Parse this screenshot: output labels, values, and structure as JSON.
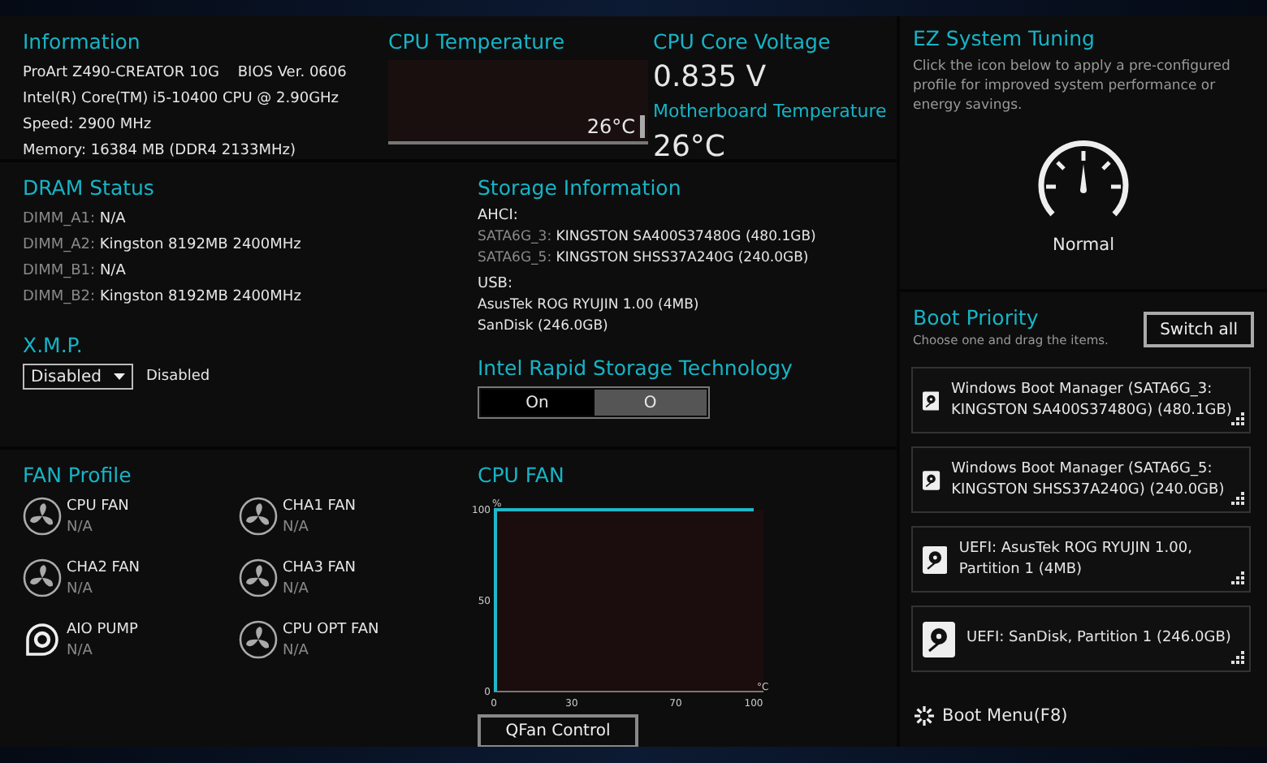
{
  "information": {
    "title": "Information",
    "lines": [
      "ProArt Z490-CREATOR 10G    BIOS Ver. 0606",
      "Intel(R) Core(TM) i5-10400 CPU @ 2.90GHz",
      "Speed: 2900 MHz",
      "Memory: 16384 MB (DDR4 2133MHz)"
    ]
  },
  "cpu_temperature": {
    "title": "CPU Temperature",
    "reading": "26°C"
  },
  "voltage": {
    "title": "CPU Core Voltage",
    "value": "0.835 V",
    "mb_title": "Motherboard Temperature",
    "mb_value": "26°C"
  },
  "dram": {
    "title": "DRAM Status",
    "slots": [
      {
        "label": "DIMM_A1:",
        "value": "N/A"
      },
      {
        "label": "DIMM_A2:",
        "value": "Kingston 8192MB 2400MHz"
      },
      {
        "label": "DIMM_B1:",
        "value": "N/A"
      },
      {
        "label": "DIMM_B2:",
        "value": "Kingston 8192MB 2400MHz"
      }
    ]
  },
  "storage": {
    "title": "Storage Information",
    "groups": [
      {
        "heading": "AHCI:",
        "items": [
          {
            "label": "SATA6G_3:",
            "value": "KINGSTON SA400S37480G (480.1GB)"
          },
          {
            "label": "SATA6G_5:",
            "value": "KINGSTON SHSS37A240G (240.0GB)"
          }
        ]
      },
      {
        "heading": "USB:",
        "items": [
          {
            "value": "AsusTek ROG RYUJIN 1.00 (4MB)"
          },
          {
            "value": "SanDisk (246.0GB)"
          }
        ]
      }
    ]
  },
  "xmp": {
    "title": "X.M.P.",
    "value": "Disabled",
    "status": "Disabled"
  },
  "rst": {
    "title": "Intel Rapid Storage Technology",
    "options": [
      {
        "label": "On",
        "selected": false
      },
      {
        "label": "O",
        "selected": true
      }
    ]
  },
  "fan_profile": {
    "title": "FAN Profile",
    "fans": [
      {
        "name": "CPU FAN",
        "value": "N/A",
        "kind": "fan"
      },
      {
        "name": "CHA1 FAN",
        "value": "N/A",
        "kind": "fan"
      },
      {
        "name": "CHA2 FAN",
        "value": "N/A",
        "kind": "fan"
      },
      {
        "name": "CHA3 FAN",
        "value": "N/A",
        "kind": "fan"
      },
      {
        "name": "AIO PUMP",
        "value": "N/A",
        "kind": "pump"
      },
      {
        "name": "CPU OPT FAN",
        "value": "N/A",
        "kind": "fan"
      }
    ]
  },
  "cpu_fan": {
    "chart_data": {
      "type": "line",
      "title": "CPU FAN",
      "xlabel": "°C",
      "ylabel": "%",
      "x": [
        0,
        100
      ],
      "series": [
        {
          "color": "#1fb8c8",
          "values": [
            100,
            100
          ]
        }
      ],
      "xlim": [
        0,
        100
      ],
      "ylim": [
        0,
        100
      ],
      "xticks": [
        0,
        30,
        70,
        100
      ],
      "yticks": [
        0,
        50,
        100
      ]
    },
    "button": "QFan Control"
  },
  "ez_tuning": {
    "title": "EZ System Tuning",
    "description": "Click the icon below to apply a pre-configured profile for improved system performance or energy savings.",
    "mode": "Normal"
  },
  "boot_priority": {
    "title": "Boot Priority",
    "hint": "Choose one and drag the items.",
    "button": "Switch all",
    "items": [
      "Windows Boot Manager (SATA6G_3: KINGSTON SA400S37480G) (480.1GB)",
      "Windows Boot Manager (SATA6G_5: KINGSTON SHSS37A240G) (240.0GB)",
      "UEFI: AsusTek ROG RYUJIN 1.00, Partition 1 (4MB)",
      "UEFI: SanDisk, Partition 1 (246.0GB)"
    ]
  },
  "boot_menu": "Boot Menu(F8)"
}
